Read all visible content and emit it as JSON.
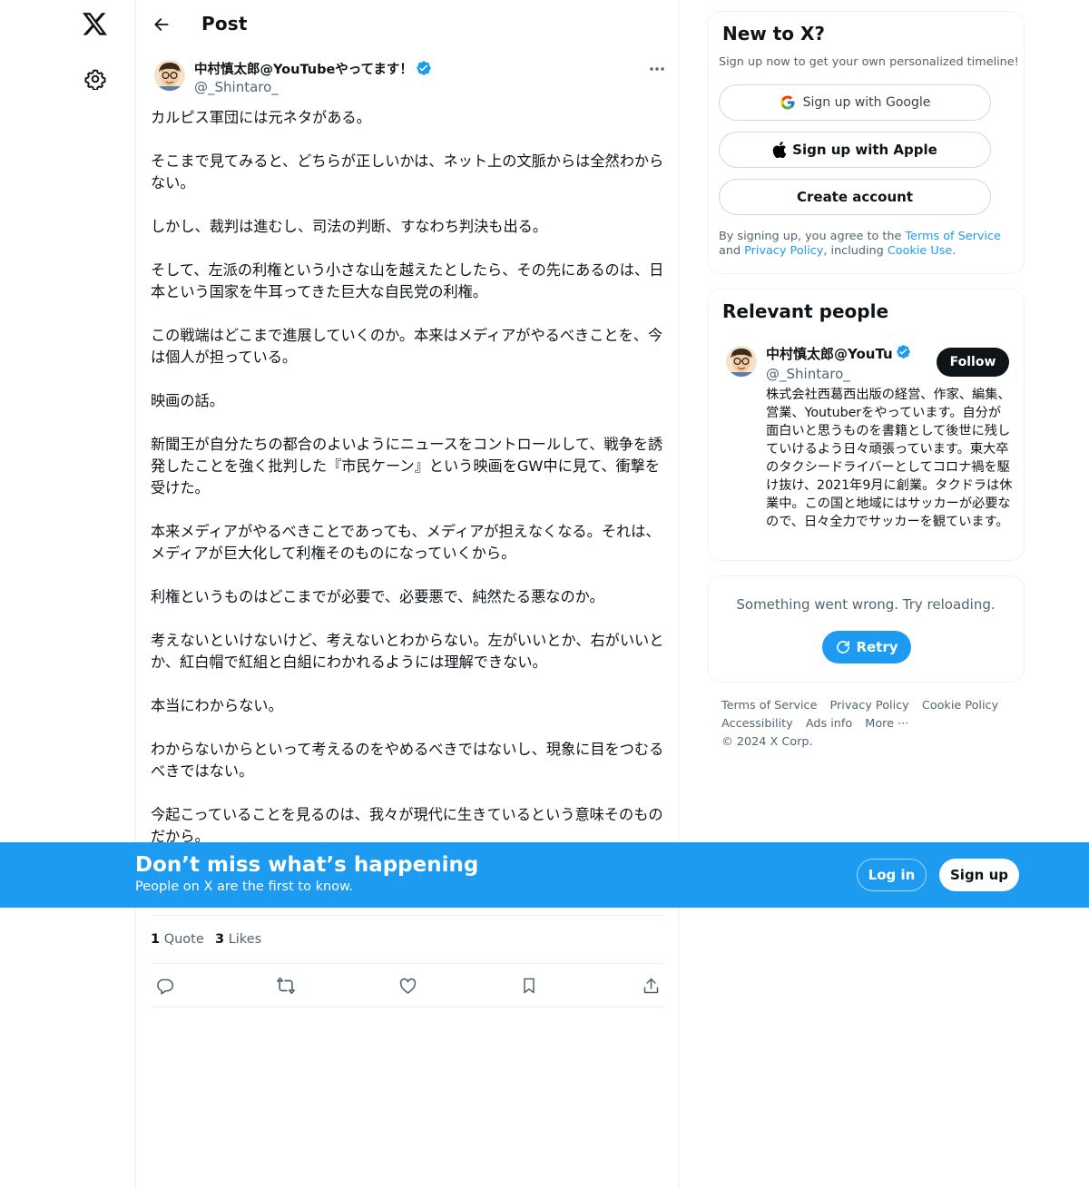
{
  "nav": {
    "logo_icon": "x-logo-icon",
    "settings_icon": "gear-icon"
  },
  "header": {
    "title": "Post"
  },
  "post": {
    "author_name": "中村慎太郎@YouTubeやってます！",
    "author_handle": "@_Shintaro_",
    "paragraphs": [
      "カルピス軍団には元ネタがある。",
      "そこまで見てみると、どちらが正しいかは、ネット上の文脈からは全然わからない。",
      "しかし、裁判は進むし、司法の判断、すなわち判決も出る。",
      "そして、左派の利権という小さな山を越えたとしたら、その先にあるのは、日本という国家を牛耳ってきた巨大な自民党の利権。",
      "この戦端はどこまで進展していくのか。本来はメディアがやるべきことを、今は個人が担っている。",
      "映画の話。",
      "新聞王が自分たちの都合のよいようにニュースをコントロールして、戦争を誘発したことを強く批判した『市民ケーン』という映画をGW中に見て、衝撃を受けた。",
      "本来メディアがやるべきことであっても、メディアが担えなくなる。それは、メディアが巨大化して利権そのものになっていくから。",
      "利権というものはどこまでが必要で、必要悪で、純然たる悪なのか。",
      "考えないといけないけど、考えないとわからない。左がいいとか、右がいいとか、紅白帽で紅組と白組にわかれるようには理解できない。",
      "本当にわからない。",
      "わからないからといって考えるのをやめるべきではないし、現象に目をつむるべきではない。",
      "今起こっていることを見るのは、我々が現代に生きているという意味そのものだから。"
    ],
    "quotes_count": "1",
    "quotes_label": "Quote",
    "likes_count": "3",
    "likes_label": "Likes"
  },
  "signup_card": {
    "title": "New to X?",
    "subtitle": "Sign up now to get your own personalized timeline!",
    "google_label": "Sign up with Google",
    "apple_label": "Sign up with Apple",
    "create_label": "Create account",
    "legal_prefix": "By signing up, you agree to the ",
    "terms_link": "Terms of Service",
    "legal_and": " and ",
    "privacy_link": "Privacy Policy",
    "legal_including": ", including ",
    "cookie_link": "Cookie Use",
    "legal_end": "."
  },
  "people_card": {
    "title": "Relevant people",
    "name": "中村慎太郎@YouTube",
    "handle": "@_Shintaro_",
    "follow_label": "Follow",
    "bio": "株式会社西葛西出版の経営、作家、編集、営業、Youtuberをやっています。自分が面白いと思うものを書籍として後世に残していけるよう日々頑張っています。東大卒のタクシードライバーとしてコロナ禍を駆け抜け、2021年9月に創業。タクドラは休業中。この国と地域にはサッカーが必要なので、日々全力でサッカーを観ています。"
  },
  "error_card": {
    "message": "Something went wrong. Try reloading.",
    "retry_label": "Retry"
  },
  "footer": {
    "links": [
      "Terms of Service",
      "Privacy Policy",
      "Cookie Policy",
      "Accessibility",
      "Ads info",
      "More ···",
      "© 2024 X Corp."
    ]
  },
  "banner": {
    "title": "Don’t miss what’s happening",
    "subtitle": "People on X are the first to know.",
    "login_label": "Log in",
    "signup_label": "Sign up"
  },
  "colors": {
    "accent": "#1d9bf0",
    "text": "#0f1419",
    "muted": "#536471",
    "border": "#eff3f4"
  }
}
